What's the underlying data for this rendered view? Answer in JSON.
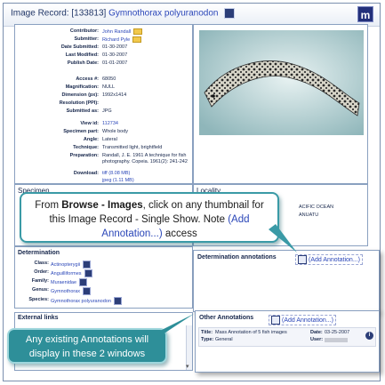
{
  "header": {
    "record_prefix": "Image Record: [133813]",
    "species_link": "Gymnothorax polyuranodon"
  },
  "record": {
    "contributor": {
      "label": "Contributor:",
      "value": "John Randall"
    },
    "submitter": {
      "label": "Submitter:",
      "value": "Richard Pyle"
    },
    "date_submitted": {
      "label": "Date Submitted:",
      "value": "01-30-2007"
    },
    "last_modified": {
      "label": "Last Modified:",
      "value": "01-30-2007"
    },
    "publish_date": {
      "label": "Publish Date:",
      "value": "01-01-2007"
    },
    "access": {
      "label": "Access #:",
      "value": "68050"
    },
    "magnification": {
      "label": "Magnification:",
      "value": "NULL"
    },
    "dimension": {
      "label": "Dimension (px):",
      "value": "1992x1414"
    },
    "resolution": {
      "label": "Resolution (PPI):",
      "value": ""
    },
    "submitted_as": {
      "label": "Submitted as:",
      "value": "JPG"
    },
    "view_id": {
      "label": "View id:",
      "value": "112734"
    },
    "specimen_part": {
      "label": "Specimen part:",
      "value": "Whole body"
    },
    "angle": {
      "label": "Angle:",
      "value": "Lateral"
    },
    "technique": {
      "label": "Technique:",
      "value": "Transmitted light, brightfield"
    },
    "preparation": {
      "label": "Preparation:",
      "value": "Randall, J. E. 1961 A technique for fish photography. Copeia. 1961(2): 241-242"
    },
    "download": {
      "label": "Download:",
      "tiff": "tiff (8.08 MB)",
      "jpeg": "jpeg (1.11 MB)"
    }
  },
  "specimen": {
    "title": "Specimen"
  },
  "locality": {
    "title": "Locality",
    "line1": "ACIFIC OCEAN",
    "line2": "ANUATU"
  },
  "determination": {
    "title": "Determination",
    "rows": [
      {
        "label": "Class:",
        "value": "Actinopterygii"
      },
      {
        "label": "Order:",
        "value": "Anguilliformes"
      },
      {
        "label": "Family:",
        "value": "Muraenidae"
      },
      {
        "label": "Genus:",
        "value": "Gymnothorax"
      },
      {
        "label": "Species:",
        "value": "Gymnothorax polyuranodon"
      }
    ]
  },
  "determination_annotations": {
    "title": "Determination annotations",
    "add_label": "(Add Annotation...)"
  },
  "external_links": {
    "title": "External links"
  },
  "other_annotations": {
    "title": "Other Annotations",
    "add_label": "(Add Annotation...)",
    "entry": {
      "title_label": "Title:",
      "title_value": "Mass Annotation of 5 fish images",
      "type_label": "Type:",
      "type_value": "General",
      "date_label": "Date:",
      "date_value": "03-25-2007",
      "user_label": "User:"
    }
  },
  "callout_top": {
    "t1": "From ",
    "t2": "Browse - Images",
    "t3": ", click on any thumbnail for this Image Record - Single Show. Note ",
    "t4": "(Add Annotation...)",
    "t5": " access"
  },
  "callout_bottom": {
    "text": "Any existing Annotations will display in these 2 windows"
  },
  "colors": {
    "accent": "#2e8f99",
    "link": "#2a46b8",
    "header": "#1f3566"
  }
}
